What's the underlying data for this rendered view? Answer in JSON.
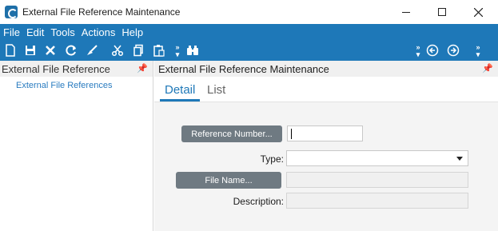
{
  "window": {
    "title": "External File Reference Maintenance"
  },
  "menu": {
    "items": [
      "File",
      "Edit",
      "Tools",
      "Actions",
      "Help"
    ]
  },
  "toolbar": {
    "icons": [
      "new-icon",
      "save-icon",
      "delete-icon",
      "refresh-icon",
      "clear-icon",
      "cut-icon",
      "copy-icon",
      "paste-icon",
      "more-icon",
      "search-icon",
      "overflow-icon",
      "back-icon",
      "forward-icon",
      "overflow-right-icon"
    ]
  },
  "left_panel": {
    "header": "External File Reference",
    "tree_item": "External File References"
  },
  "right_panel": {
    "header": "External File Reference Maintenance",
    "tabs": [
      {
        "label": "Detail",
        "active": true
      },
      {
        "label": "List",
        "active": false
      }
    ]
  },
  "form": {
    "reference_number_button": "Reference Number...",
    "reference_number_value": "",
    "type_label": "Type:",
    "type_value": "",
    "file_name_button": "File Name...",
    "file_name_value": "",
    "description_label": "Description:",
    "description_value": ""
  },
  "colors": {
    "accent": "#1e78b8",
    "button_gray": "#6f7a82",
    "link_blue": "#2a7cc0"
  }
}
